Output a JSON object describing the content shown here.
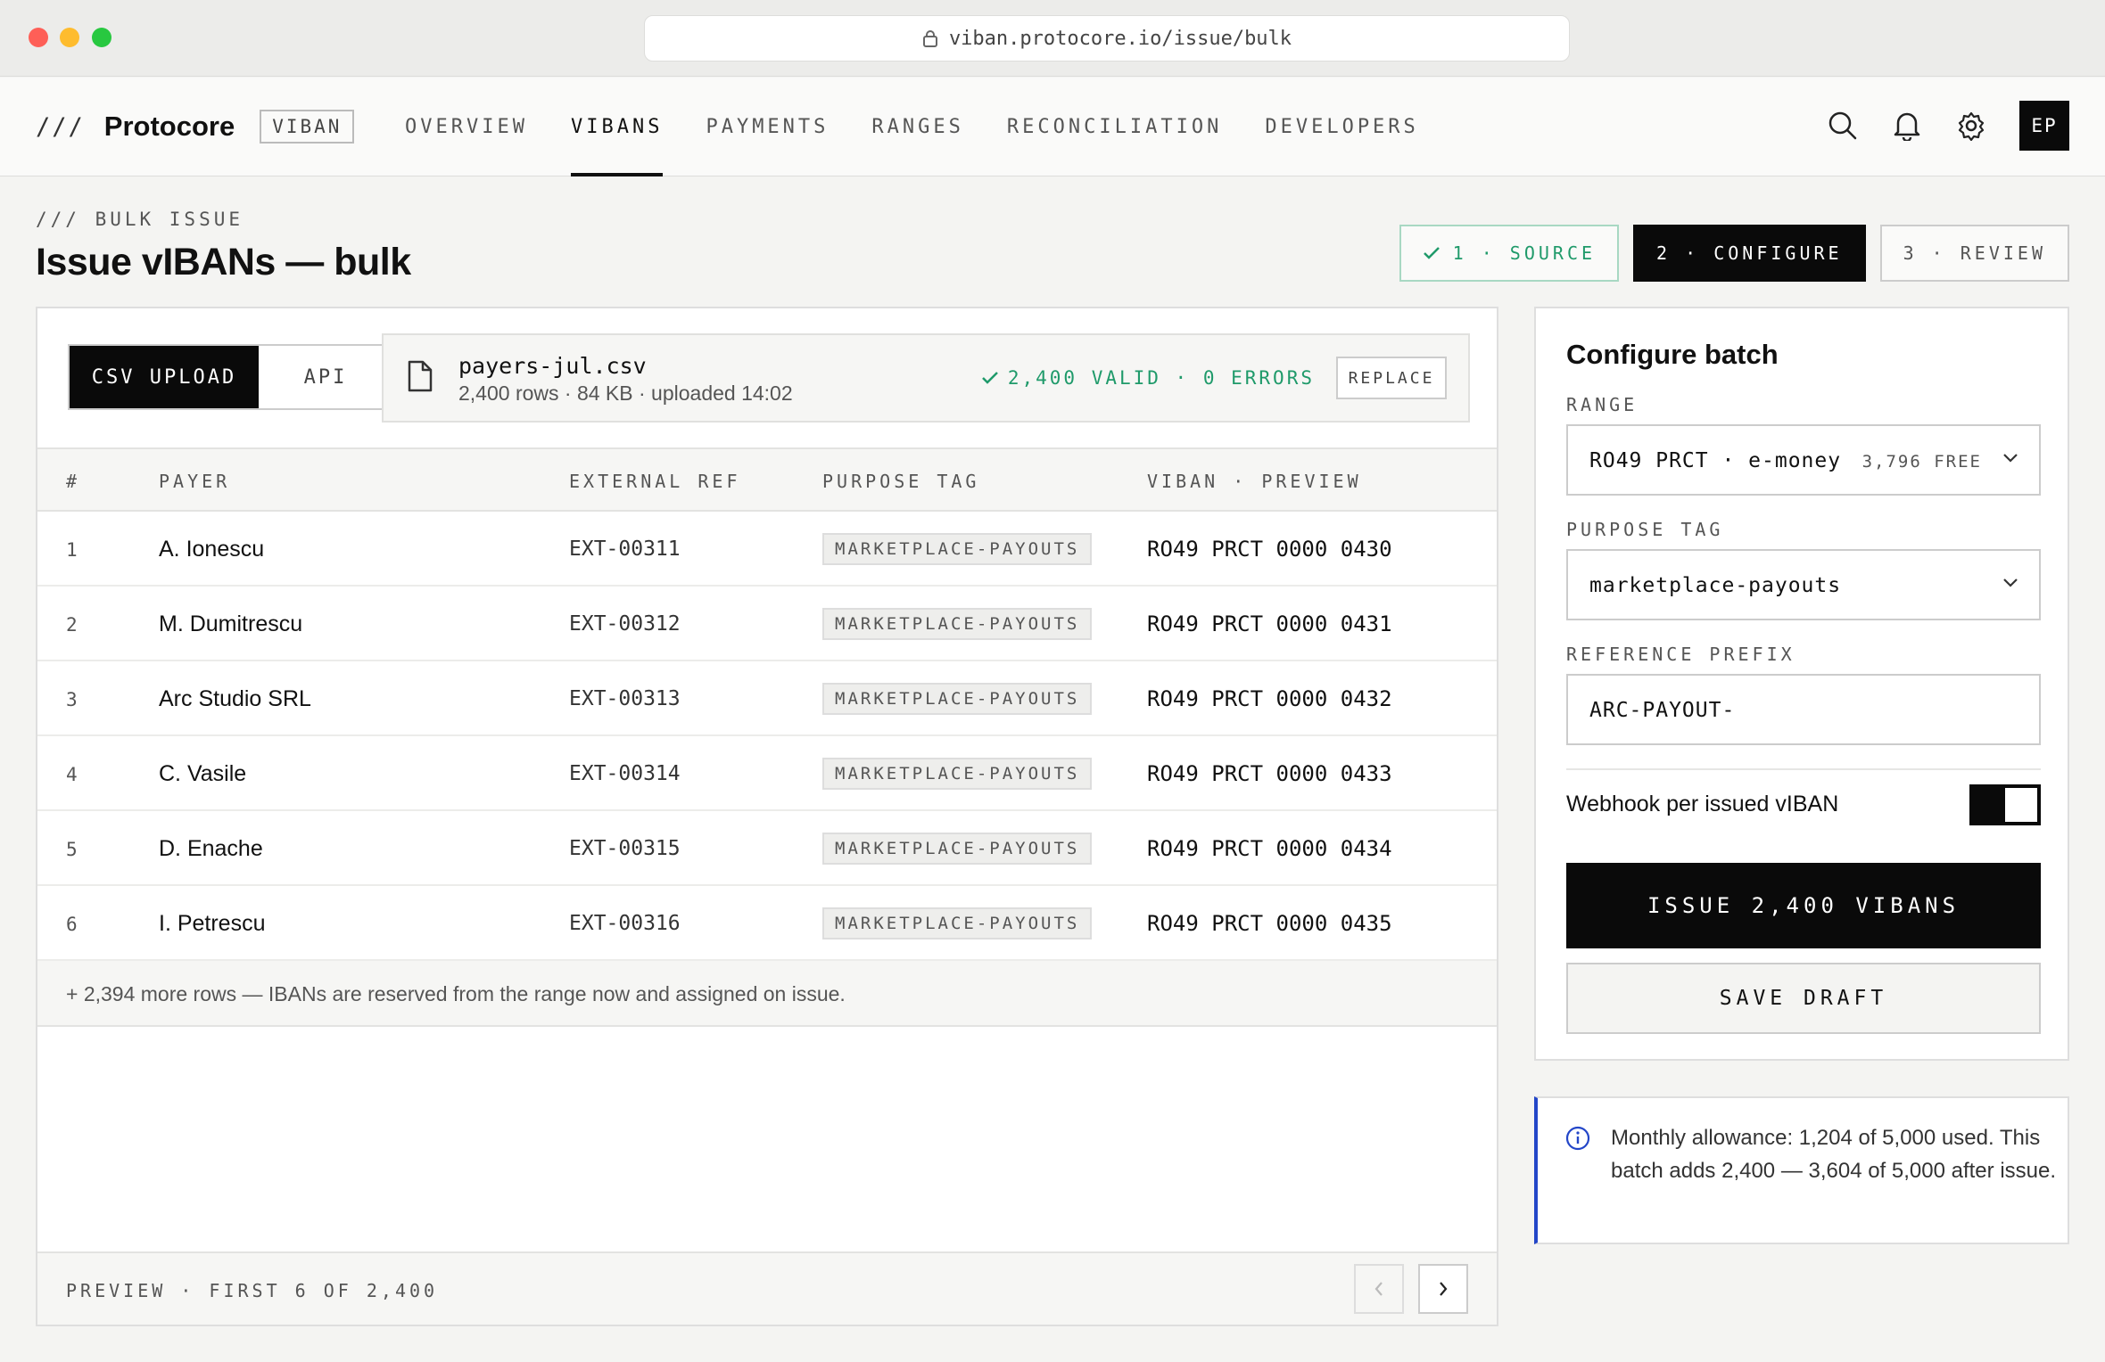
{
  "browser": {
    "url": "viban.protocore.io/issue/bulk"
  },
  "header": {
    "slashes": "///",
    "brand": "Protocore",
    "badge": "VIBAN",
    "nav": [
      "OVERVIEW",
      "VIBANS",
      "PAYMENTS",
      "RANGES",
      "RECONCILIATION",
      "DEVELOPERS"
    ],
    "active_nav": "VIBANS",
    "avatar": "EP"
  },
  "page": {
    "eyebrow": "/// BULK ISSUE",
    "title": "Issue vIBANs — bulk"
  },
  "steps": [
    {
      "label": "1 · SOURCE",
      "state": "done"
    },
    {
      "label": "2 · CONFIGURE",
      "state": "active"
    },
    {
      "label": "3 · REVIEW",
      "state": "pending"
    }
  ],
  "source": {
    "tabs": [
      "CSV UPLOAD",
      "API"
    ],
    "active_tab": "CSV UPLOAD",
    "file_name": "payers-jul.csv",
    "file_meta": "2,400 rows · 84 KB · uploaded 14:02",
    "status": "2,400 VALID · 0 ERRORS",
    "replace_label": "REPLACE"
  },
  "table": {
    "columns": [
      "#",
      "PAYER",
      "EXTERNAL REF",
      "PURPOSE TAG",
      "VIBAN · PREVIEW"
    ],
    "rows": [
      {
        "num": "1",
        "payer": "A. Ionescu",
        "ref": "EXT-00311",
        "tag": "MARKETPLACE-PAYOUTS",
        "viban": "RO49 PRCT 0000 0430"
      },
      {
        "num": "2",
        "payer": "M. Dumitrescu",
        "ref": "EXT-00312",
        "tag": "MARKETPLACE-PAYOUTS",
        "viban": "RO49 PRCT 0000 0431"
      },
      {
        "num": "3",
        "payer": "Arc Studio SRL",
        "ref": "EXT-00313",
        "tag": "MARKETPLACE-PAYOUTS",
        "viban": "RO49 PRCT 0000 0432"
      },
      {
        "num": "4",
        "payer": "C. Vasile",
        "ref": "EXT-00314",
        "tag": "MARKETPLACE-PAYOUTS",
        "viban": "RO49 PRCT 0000 0433"
      },
      {
        "num": "5",
        "payer": "D. Enache",
        "ref": "EXT-00315",
        "tag": "MARKETPLACE-PAYOUTS",
        "viban": "RO49 PRCT 0000 0434"
      },
      {
        "num": "6",
        "payer": "I. Petrescu",
        "ref": "EXT-00316",
        "tag": "MARKETPLACE-PAYOUTS",
        "viban": "RO49 PRCT 0000 0435"
      }
    ],
    "more_rows": "+ 2,394 more rows — IBANs are reserved from the range now and assigned on issue.",
    "footer": "PREVIEW · FIRST 6 OF 2,400"
  },
  "configure": {
    "title": "Configure batch",
    "range_label": "RANGE",
    "range_value": "RO49 PRCT · e-money",
    "range_free": "3,796 FREE",
    "purpose_label": "PURPOSE TAG",
    "purpose_value": "marketplace-payouts",
    "prefix_label": "REFERENCE PREFIX",
    "prefix_value": "ARC-PAYOUT-",
    "webhook_label": "Webhook per issued vIBAN",
    "webhook_on": true,
    "issue_label": "ISSUE 2,400 VIBANS",
    "draft_label": "SAVE DRAFT"
  },
  "info": {
    "text": "Monthly allowance: 1,204 of 5,000 used. This batch adds 2,400 — 3,604 of 5,000 after issue."
  },
  "colors": {
    "success": "#1f9a6a",
    "primary": "#0a0a0a",
    "info_accent": "#2346c8"
  }
}
